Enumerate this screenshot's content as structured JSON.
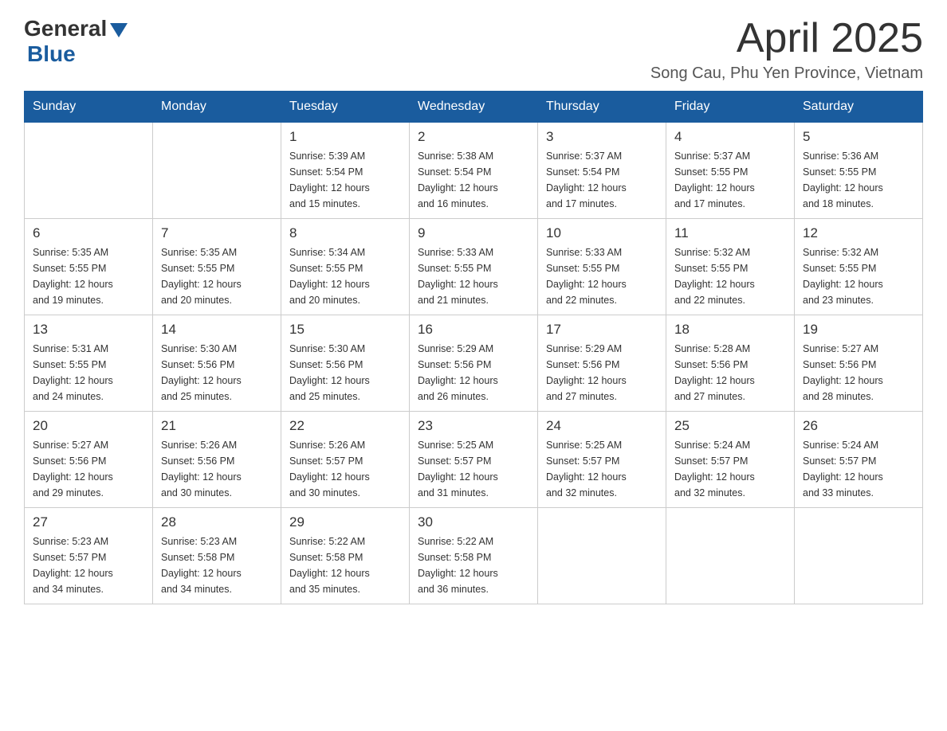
{
  "logo": {
    "general": "General",
    "arrow": "▼",
    "blue": "Blue"
  },
  "header": {
    "month": "April 2025",
    "location": "Song Cau, Phu Yen Province, Vietnam"
  },
  "days": {
    "headers": [
      "Sunday",
      "Monday",
      "Tuesday",
      "Wednesday",
      "Thursday",
      "Friday",
      "Saturday"
    ]
  },
  "weeks": [
    {
      "cells": [
        {
          "day": "",
          "info": ""
        },
        {
          "day": "",
          "info": ""
        },
        {
          "day": "1",
          "info": "Sunrise: 5:39 AM\nSunset: 5:54 PM\nDaylight: 12 hours\nand 15 minutes."
        },
        {
          "day": "2",
          "info": "Sunrise: 5:38 AM\nSunset: 5:54 PM\nDaylight: 12 hours\nand 16 minutes."
        },
        {
          "day": "3",
          "info": "Sunrise: 5:37 AM\nSunset: 5:54 PM\nDaylight: 12 hours\nand 17 minutes."
        },
        {
          "day": "4",
          "info": "Sunrise: 5:37 AM\nSunset: 5:55 PM\nDaylight: 12 hours\nand 17 minutes."
        },
        {
          "day": "5",
          "info": "Sunrise: 5:36 AM\nSunset: 5:55 PM\nDaylight: 12 hours\nand 18 minutes."
        }
      ]
    },
    {
      "cells": [
        {
          "day": "6",
          "info": "Sunrise: 5:35 AM\nSunset: 5:55 PM\nDaylight: 12 hours\nand 19 minutes."
        },
        {
          "day": "7",
          "info": "Sunrise: 5:35 AM\nSunset: 5:55 PM\nDaylight: 12 hours\nand 20 minutes."
        },
        {
          "day": "8",
          "info": "Sunrise: 5:34 AM\nSunset: 5:55 PM\nDaylight: 12 hours\nand 20 minutes."
        },
        {
          "day": "9",
          "info": "Sunrise: 5:33 AM\nSunset: 5:55 PM\nDaylight: 12 hours\nand 21 minutes."
        },
        {
          "day": "10",
          "info": "Sunrise: 5:33 AM\nSunset: 5:55 PM\nDaylight: 12 hours\nand 22 minutes."
        },
        {
          "day": "11",
          "info": "Sunrise: 5:32 AM\nSunset: 5:55 PM\nDaylight: 12 hours\nand 22 minutes."
        },
        {
          "day": "12",
          "info": "Sunrise: 5:32 AM\nSunset: 5:55 PM\nDaylight: 12 hours\nand 23 minutes."
        }
      ]
    },
    {
      "cells": [
        {
          "day": "13",
          "info": "Sunrise: 5:31 AM\nSunset: 5:55 PM\nDaylight: 12 hours\nand 24 minutes."
        },
        {
          "day": "14",
          "info": "Sunrise: 5:30 AM\nSunset: 5:56 PM\nDaylight: 12 hours\nand 25 minutes."
        },
        {
          "day": "15",
          "info": "Sunrise: 5:30 AM\nSunset: 5:56 PM\nDaylight: 12 hours\nand 25 minutes."
        },
        {
          "day": "16",
          "info": "Sunrise: 5:29 AM\nSunset: 5:56 PM\nDaylight: 12 hours\nand 26 minutes."
        },
        {
          "day": "17",
          "info": "Sunrise: 5:29 AM\nSunset: 5:56 PM\nDaylight: 12 hours\nand 27 minutes."
        },
        {
          "day": "18",
          "info": "Sunrise: 5:28 AM\nSunset: 5:56 PM\nDaylight: 12 hours\nand 27 minutes."
        },
        {
          "day": "19",
          "info": "Sunrise: 5:27 AM\nSunset: 5:56 PM\nDaylight: 12 hours\nand 28 minutes."
        }
      ]
    },
    {
      "cells": [
        {
          "day": "20",
          "info": "Sunrise: 5:27 AM\nSunset: 5:56 PM\nDaylight: 12 hours\nand 29 minutes."
        },
        {
          "day": "21",
          "info": "Sunrise: 5:26 AM\nSunset: 5:56 PM\nDaylight: 12 hours\nand 30 minutes."
        },
        {
          "day": "22",
          "info": "Sunrise: 5:26 AM\nSunset: 5:57 PM\nDaylight: 12 hours\nand 30 minutes."
        },
        {
          "day": "23",
          "info": "Sunrise: 5:25 AM\nSunset: 5:57 PM\nDaylight: 12 hours\nand 31 minutes."
        },
        {
          "day": "24",
          "info": "Sunrise: 5:25 AM\nSunset: 5:57 PM\nDaylight: 12 hours\nand 32 minutes."
        },
        {
          "day": "25",
          "info": "Sunrise: 5:24 AM\nSunset: 5:57 PM\nDaylight: 12 hours\nand 32 minutes."
        },
        {
          "day": "26",
          "info": "Sunrise: 5:24 AM\nSunset: 5:57 PM\nDaylight: 12 hours\nand 33 minutes."
        }
      ]
    },
    {
      "cells": [
        {
          "day": "27",
          "info": "Sunrise: 5:23 AM\nSunset: 5:57 PM\nDaylight: 12 hours\nand 34 minutes."
        },
        {
          "day": "28",
          "info": "Sunrise: 5:23 AM\nSunset: 5:58 PM\nDaylight: 12 hours\nand 34 minutes."
        },
        {
          "day": "29",
          "info": "Sunrise: 5:22 AM\nSunset: 5:58 PM\nDaylight: 12 hours\nand 35 minutes."
        },
        {
          "day": "30",
          "info": "Sunrise: 5:22 AM\nSunset: 5:58 PM\nDaylight: 12 hours\nand 36 minutes."
        },
        {
          "day": "",
          "info": ""
        },
        {
          "day": "",
          "info": ""
        },
        {
          "day": "",
          "info": ""
        }
      ]
    }
  ]
}
